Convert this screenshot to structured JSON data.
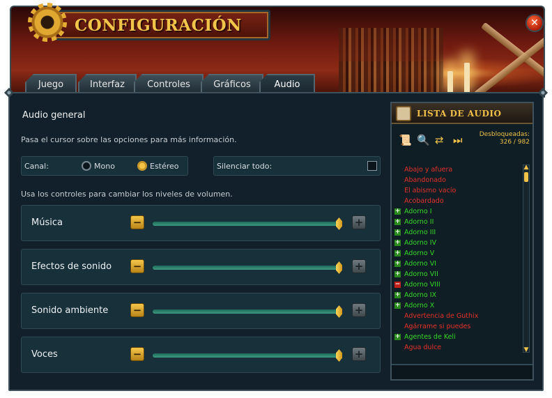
{
  "window": {
    "title": "CONFIGURACIÓN",
    "close_symbol": "✕"
  },
  "tabs": [
    {
      "label": "Juego",
      "active": false
    },
    {
      "label": "Interfaz",
      "active": false
    },
    {
      "label": "Controles",
      "active": false
    },
    {
      "label": "Gráficos",
      "active": false
    },
    {
      "label": "Audio",
      "active": true
    }
  ],
  "audio": {
    "section_title": "Audio general",
    "hint": "Pasa el cursor sobre las opciones para más información.",
    "channel": {
      "label": "Canal:",
      "options": [
        {
          "label": "Mono",
          "selected": false
        },
        {
          "label": "Estéreo",
          "selected": true
        }
      ]
    },
    "mute_all": {
      "label": "Silenciar todo:",
      "checked": false
    },
    "volume_hint": "Usa los controles para cambiar los niveles de volumen.",
    "sliders": [
      {
        "label": "Música",
        "level": 1.0
      },
      {
        "label": "Efectos de sonido",
        "level": 1.0
      },
      {
        "label": "Sonido ambiente",
        "level": 1.0
      },
      {
        "label": "Voces",
        "level": 1.0
      }
    ],
    "minus_symbol": "−",
    "plus_symbol": "+"
  },
  "audio_list": {
    "title": "LISTA DE AUDIO",
    "tools": [
      {
        "icon": "scroll-icon",
        "glyph": "📜"
      },
      {
        "icon": "search-icon",
        "glyph": "🔍"
      },
      {
        "icon": "shuffle-icon",
        "glyph": "⇄"
      },
      {
        "icon": "skip-next-icon",
        "glyph": "⏭"
      }
    ],
    "unlocked_label": "Desbloqueadas:",
    "unlocked_count": "326 / 982",
    "tracks": [
      {
        "name": "Abajo y afuera",
        "unlocked": false,
        "expander": ""
      },
      {
        "name": "Abandonado",
        "unlocked": false,
        "expander": ""
      },
      {
        "name": "El abismo vacío",
        "unlocked": false,
        "expander": ""
      },
      {
        "name": "Acobardado",
        "unlocked": false,
        "expander": ""
      },
      {
        "name": "Adorno I",
        "unlocked": true,
        "expander": "+"
      },
      {
        "name": "Adorno II",
        "unlocked": true,
        "expander": "+"
      },
      {
        "name": "Adorno III",
        "unlocked": true,
        "expander": "+"
      },
      {
        "name": "Adorno IV",
        "unlocked": true,
        "expander": "+"
      },
      {
        "name": "Adorno V",
        "unlocked": true,
        "expander": "+"
      },
      {
        "name": "Adorno VI",
        "unlocked": true,
        "expander": "+"
      },
      {
        "name": "Adorno VII",
        "unlocked": true,
        "expander": "+"
      },
      {
        "name": "Adorno VIII",
        "unlocked": true,
        "expander": "−"
      },
      {
        "name": "Adorno IX",
        "unlocked": true,
        "expander": "+"
      },
      {
        "name": "Adorno X",
        "unlocked": true,
        "expander": "+"
      },
      {
        "name": "Advertencia de Guthix",
        "unlocked": false,
        "expander": ""
      },
      {
        "name": "Agárrame si puedes",
        "unlocked": false,
        "expander": ""
      },
      {
        "name": "Agentes de Keli",
        "unlocked": true,
        "expander": "+"
      },
      {
        "name": "Agua dulce",
        "unlocked": false,
        "expander": ""
      }
    ],
    "scroll_up": "▲",
    "scroll_down": "▼"
  },
  "colors": {
    "locked": "#e0322a",
    "unlocked": "#35d82a",
    "accent_gold": "#f0c24a"
  }
}
